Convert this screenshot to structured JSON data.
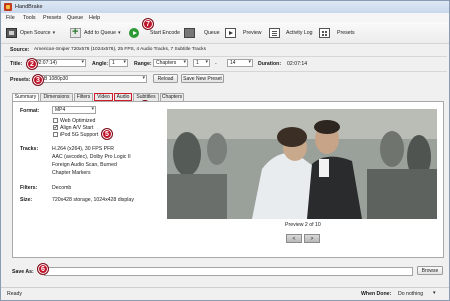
{
  "window": {
    "title": "HandBrake"
  },
  "menu": [
    "File",
    "Tools",
    "Presets",
    "Queue",
    "Help"
  ],
  "toolbar": {
    "open_source": "Open Source",
    "add_to_queue": "Add to Queue",
    "start_encode": "Start Encode",
    "queue": "Queue",
    "preview": "Preview",
    "activity_log": "Activity Log",
    "presets": "Presets"
  },
  "source": {
    "label": "Source:",
    "value": "American-Sniper   720x576 (1024x576), 25 FPS, 4 Audio Tracks, 7 Subtitle Tracks"
  },
  "title_row": {
    "title_label": "Title:",
    "title_value": "1 (02:07:14)",
    "angle_label": "Angle:",
    "angle_value": "1",
    "range_label": "Range:",
    "range_type": "Chapters",
    "range_start": "1",
    "range_sep": "-",
    "range_end": "14",
    "duration_label": "Duration:",
    "duration_value": "02:07:14"
  },
  "presets_row": {
    "label": "Presets:",
    "value": "B 1080p30",
    "reload": "Reload",
    "save_new": "Save New Preset"
  },
  "tabs": [
    "Summary",
    "Dimensions",
    "Filters",
    "Video",
    "Audio",
    "Subtitles",
    "Chapters"
  ],
  "summary": {
    "format_label": "Format:",
    "format_value": "MP4",
    "web_optimized": "Web Optimized",
    "align_av": "Align A/V Start",
    "ipod": "iPod 5G Support",
    "tracks_label": "Tracks:",
    "tracks": [
      "H.264 (x264), 30 FPS PFR",
      "AAC (avcodec), Dolby Pro Logic II",
      "Foreign Audio Scan, Burned",
      "Chapter Markers"
    ],
    "filters_label": "Filters:",
    "filters_value": "Decomb",
    "size_label": "Size:",
    "size_value": "720x428 storage, 1024x428 display"
  },
  "preview": {
    "caption": "Preview 2 of 10",
    "prev": "<",
    "next": ">"
  },
  "save_as": {
    "label": "Save As:",
    "value": "",
    "browse": "Browse"
  },
  "status": {
    "text": "Ready",
    "when_done_label": "When Done:",
    "when_done_value": "Do nothing"
  },
  "callouts": [
    "2",
    "3",
    "4",
    "5",
    "6",
    "7"
  ],
  "colors": {
    "callout": "#c0162c",
    "encode_green": "#2b9a35"
  }
}
